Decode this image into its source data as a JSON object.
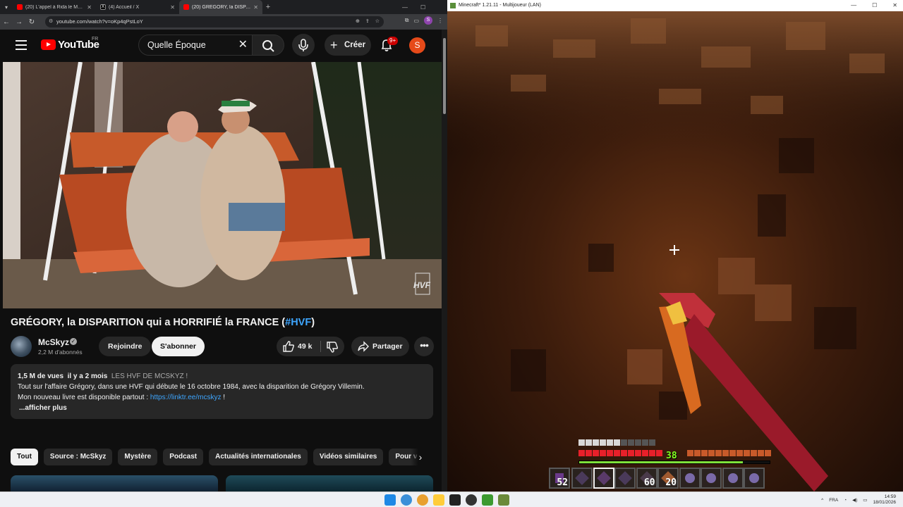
{
  "browser": {
    "tabs": [
      {
        "title": "(20) L'appel à Rida le Marseillais",
        "icon": "youtube-icon",
        "active": false
      },
      {
        "title": "(4) Accueil / X",
        "icon": "x-icon",
        "active": false
      },
      {
        "title": "(20) GRÉGORY, la DISPARITION",
        "icon": "youtube-icon",
        "active": true
      }
    ],
    "new_tab": "+",
    "url": "youtube.com/watch?v=oKp4qPstLoY",
    "profile_initial": "S"
  },
  "youtube": {
    "logo_text": "YouTube",
    "country": "FR",
    "search_value": "Quelle Époque",
    "create_label": "Créer",
    "notif_badge": "9+",
    "avatar_initial": "S",
    "video": {
      "title_main": "GRÉGORY, la DISPARITION qui a HORRIFIÉ la FRANCE (",
      "title_tag": "#HVF",
      "title_end": ")",
      "watermark": "HVF",
      "channel": "McSkyz",
      "subscribers": "2,2 M d'abonnés",
      "join_label": "Rejoindre",
      "subscribe_label": "S'abonner",
      "likes": "49 k",
      "share_label": "Partager"
    },
    "description": {
      "views": "1,5 M de vues",
      "age": "il y a 2 mois",
      "hashtags": "LES HVF DE MCSKYZ !",
      "line1": "Tout sur l'affaire Grégory, dans une HVF qui débute le 16 octobre 1984, avec la disparition de Grégory Villemin.",
      "line2_pre": "Mon nouveau livre est disponible partout : ",
      "line2_link": "https://linktr.ee/mcskyz",
      "line2_post": " !",
      "more": "...afficher plus"
    },
    "chips": [
      "Tout",
      "Source : McSkyz",
      "Mystère",
      "Podcast",
      "Actualités internationales",
      "Vidéos similaires",
      "Pour v"
    ]
  },
  "minecraft": {
    "window_title": "Minecraft* 1.21.11 - Multijoueur (LAN)",
    "xp_level": "38",
    "xp_progress": 0.86,
    "health_hearts": 10,
    "hunger": 10,
    "armor": 10,
    "hotbar": [
      {
        "item": "enchanted-book-icon",
        "count": "52"
      },
      {
        "item": "netherite-sword-icon",
        "count": ""
      },
      {
        "item": "netherite-pickaxe-icon",
        "count": "",
        "selected": true
      },
      {
        "item": "netherite-shovel-icon",
        "count": ""
      },
      {
        "item": "netherite-axe-icon",
        "count": "60"
      },
      {
        "item": "cooked-food-icon",
        "count": "20"
      },
      {
        "item": "ender-pearl-icon",
        "count": ""
      },
      {
        "item": "ender-pearl-icon",
        "count": ""
      },
      {
        "item": "ender-pearl-icon",
        "count": ""
      },
      {
        "item": "ender-pearl-icon",
        "count": ""
      }
    ]
  },
  "taskbar": {
    "language": "FRA",
    "time": "14:59",
    "date": "18/01/2026"
  }
}
